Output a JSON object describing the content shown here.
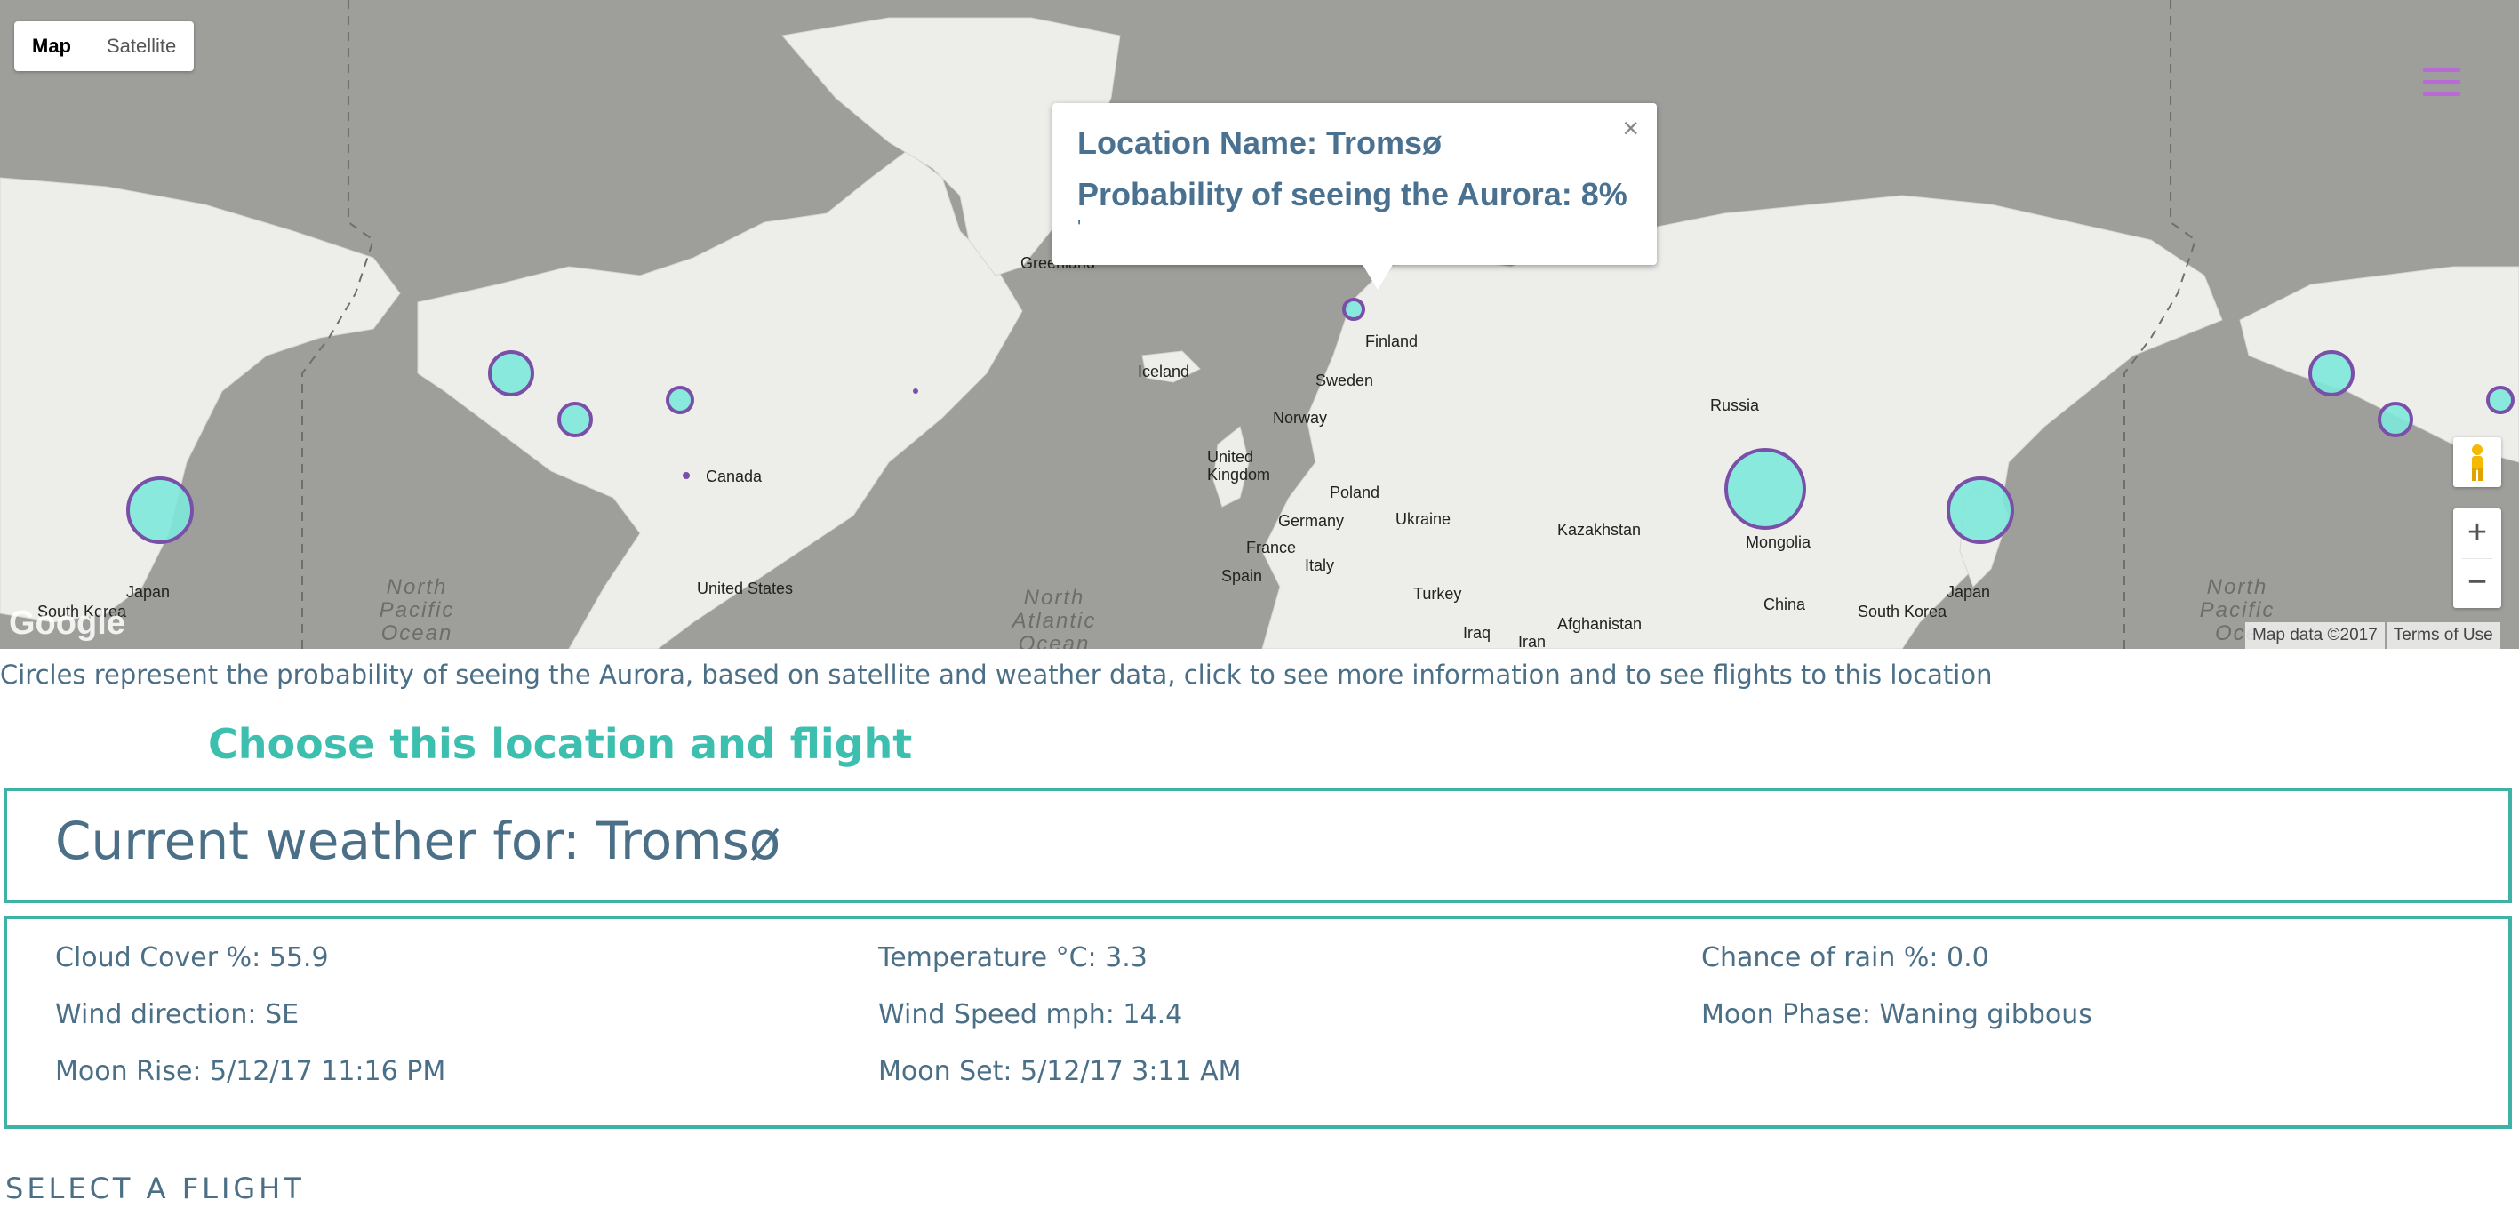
{
  "map": {
    "type_control": {
      "map_label": "Map",
      "satellite_label": "Satellite"
    },
    "google_logo": "Google",
    "attribution": {
      "map_data": "Map data ©2017",
      "terms": "Terms of Use"
    },
    "zoom": {
      "in": "+",
      "out": "−"
    },
    "labels": {
      "greenland": "Greenland",
      "iceland": "Iceland",
      "finland": "Finland",
      "sweden": "Sweden",
      "norway": "Norway",
      "united_kingdom": "United\nKingdom",
      "poland": "Poland",
      "germany": "Germany",
      "ukraine": "Ukraine",
      "france": "France",
      "italy": "Italy",
      "spain": "Spain",
      "turkey": "Turkey",
      "iraq": "Iraq",
      "iran": "Iran",
      "afghanistan": "Afghanistan",
      "kazakhstan": "Kazakhstan",
      "russia": "Russia",
      "mongolia": "Mongolia",
      "china": "China",
      "south_korea_left": "South Korea",
      "japan_left": "Japan",
      "south_korea_right": "South Korea",
      "japan_right": "Japan",
      "canada": "Canada",
      "united_states": "United States"
    },
    "oceans": {
      "north_pacific_left": "North\nPacific\nOcean",
      "north_atlantic": "North\nAtlantic\nOcean",
      "north_pacific_right": "North\nPacific\nOce"
    },
    "infowindow": {
      "location_line": "Location Name: Tromsø",
      "probability_line": "Probability of seeing the Aurora: 8%",
      "extra": "'",
      "close": "×"
    },
    "circle_color": "#7de8dc",
    "circle_stroke": "#7a4fa8"
  },
  "caption": "Circles represent the probability of seeing the Aurora, based on satellite and weather data, click to see more information and to see flights to this location",
  "choose_link": "Choose this location and flight",
  "weather": {
    "title": "Current weather for: Tromsø",
    "cloud_cover": "Cloud Cover %: 55.9",
    "temperature": "Temperature °C: 3.3",
    "chance_of_rain": "Chance of rain %: 0.0",
    "wind_direction": "Wind direction: SE",
    "wind_speed": "Wind Speed mph: 14.4",
    "moon_phase": "Moon Phase: Waning gibbous",
    "moon_rise": "Moon Rise: 5/12/17 11:16 PM",
    "moon_set": "Moon Set: 5/12/17 3:11 AM"
  },
  "select_flight": "SELECT A FLIGHT",
  "colors": {
    "accent_teal": "#3eb3a5",
    "text_blue": "#4a6f86",
    "menu_purple": "#b86bd4"
  }
}
